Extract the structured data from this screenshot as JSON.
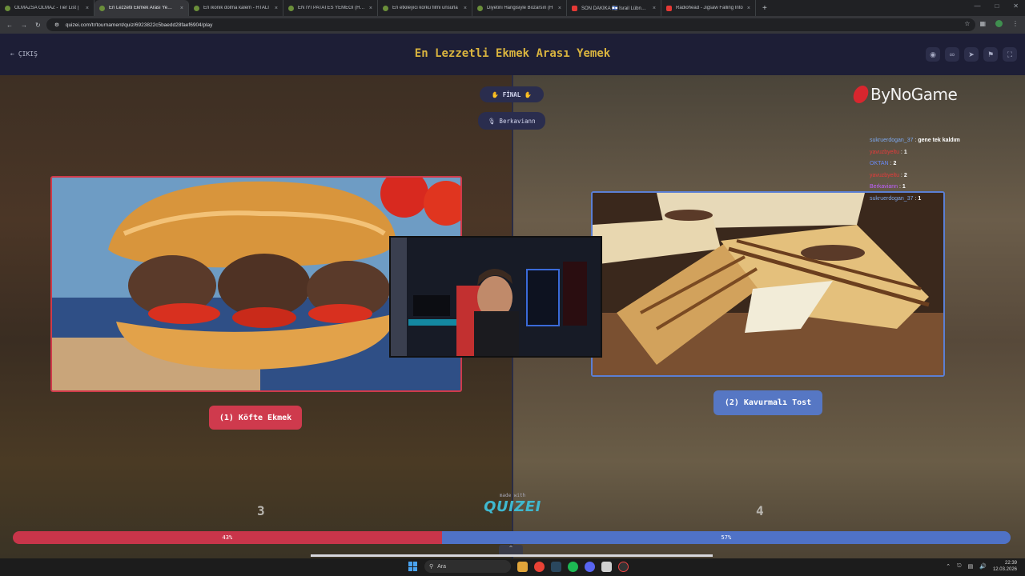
{
  "browser": {
    "tabs": [
      {
        "title": "OLMAZSA OLMAZ - Tier List |",
        "icon": "page-icon",
        "active": false
      },
      {
        "title": "En Lezzetli Ekmek Arası Yemek",
        "icon": "page-icon",
        "active": true
      },
      {
        "title": "En ikonik dolma kalem - HTALI",
        "icon": "page-icon",
        "active": false
      },
      {
        "title": "EN İYİ PATATES YEMEĞİ (HTALI",
        "icon": "page-icon",
        "active": false
      },
      {
        "title": "En etkileyici korku filmi unsurla",
        "icon": "page-icon",
        "active": false
      },
      {
        "title": "Diyetini Hangisiyle Bozarsın (H",
        "icon": "page-icon",
        "active": false
      },
      {
        "title": "SON DAKİKA 🇮🇱 İsrail Lübnan'ı",
        "icon": "youtube-icon",
        "active": false
      },
      {
        "title": "Radiohead - Jigsaw Falling Into",
        "icon": "youtube-icon",
        "active": false
      }
    ],
    "close_glyph": "×",
    "new_tab_glyph": "+",
    "url": "quizei.com/tr/tournament/quiz/6923822c5baedd28faef6904/play"
  },
  "header": {
    "exit_label": "ÇIKIŞ",
    "title": "En Lezzetli Ekmek Arası Yemek"
  },
  "round": {
    "stage_label": "✋ FİNAL ✋",
    "user_label": "🎙 Berkaviann"
  },
  "left_choice": {
    "label": "(1) Köfte Ekmek",
    "votes": "3",
    "percent_label": "43%",
    "percent_value": 43
  },
  "right_choice": {
    "label": "(2) Kavurmalı Tost",
    "votes": "4",
    "percent_label": "57%",
    "percent_value": 57
  },
  "footer": {
    "made_with": "made with",
    "logo": "QUIZEI"
  },
  "overlay": {
    "brand": "ByNoGame",
    "chat": [
      {
        "user": "sukruerdogan_37",
        "message": "gene tek kaldım"
      },
      {
        "user": "yavuzbyeltu",
        "message": "1"
      },
      {
        "user": "OKTAN",
        "message": "2"
      },
      {
        "user": "yavuzbyeltu",
        "message": "2"
      },
      {
        "user": "Berkaviann",
        "message": "1"
      },
      {
        "user": "sukruerdogan_37",
        "message": "1"
      }
    ]
  },
  "taskbar": {
    "search_placeholder": "Ara",
    "time": "22:39",
    "date": "12.03.2026"
  },
  "colors": {
    "left_accent": "#cf3a4d",
    "right_accent": "#5677c4",
    "title_gold": "#d9b43f"
  }
}
